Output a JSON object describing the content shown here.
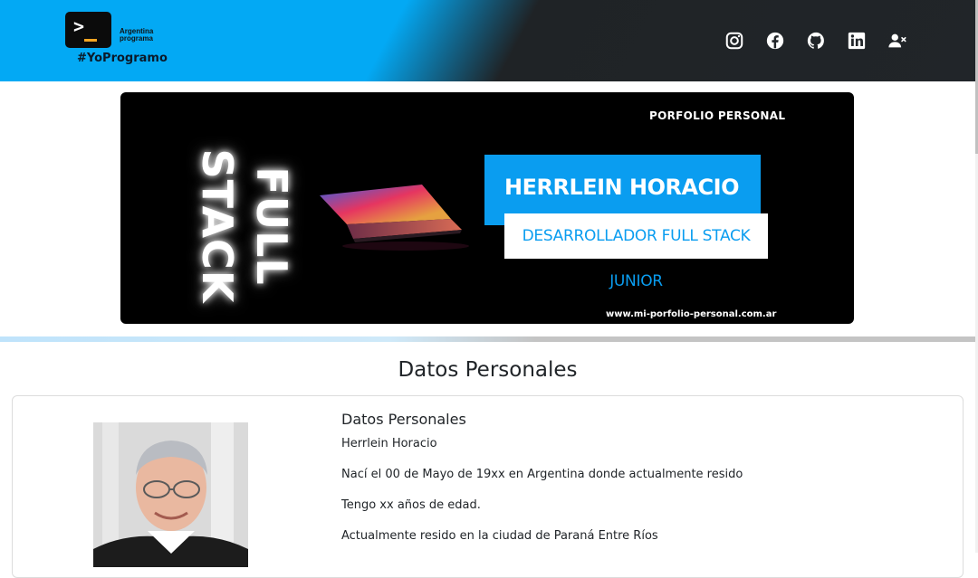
{
  "header": {
    "logo_line1": "Argentina",
    "logo_line2": "programa",
    "hashtag": "#YoProgramo",
    "social": [
      "instagram-icon",
      "facebook-icon",
      "github-icon",
      "linkedin-icon",
      "logout-user-icon"
    ]
  },
  "banner": {
    "side_text": "FULL STACK",
    "tagline": "PORFOLIO PERSONAL",
    "name": "HERRLEIN HORACIO",
    "role": "DESARROLLADOR FULL STACK JUNIOR",
    "url": "www.mi-porfolio-personal.com.ar"
  },
  "section": {
    "title": "Datos Personales",
    "card_title": "Datos Personales",
    "lines": [
      "Herrlein Horacio",
      "Nací el 00 de Mayo de 19xx en Argentina donde actualmente resido",
      "Tengo xx años de edad.",
      "Actualmente resido en la ciudad de Paraná Entre Ríos"
    ]
  },
  "colors": {
    "accent": "#03a9f4",
    "dark": "#212529"
  }
}
